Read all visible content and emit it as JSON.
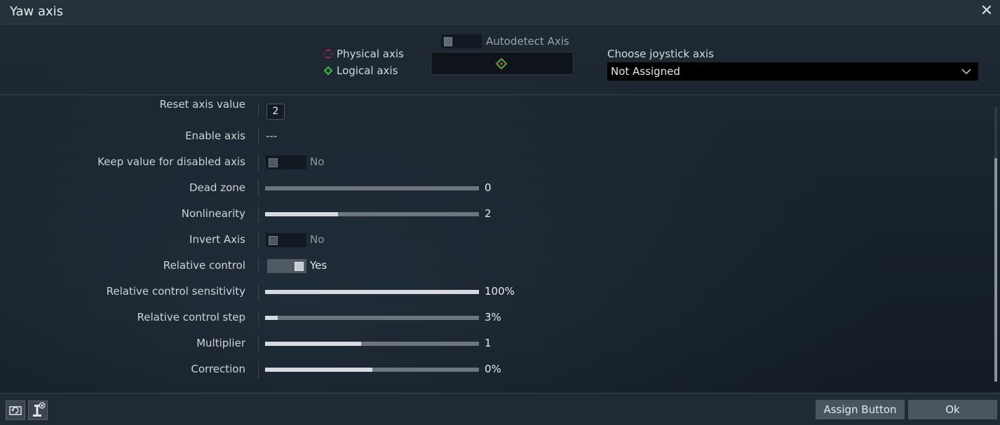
{
  "window": {
    "title": "Yaw axis"
  },
  "legend": {
    "physical": "Physical axis",
    "logical": "Logical axis"
  },
  "autodetect": {
    "label": "Autodetect Axis",
    "enabled": false
  },
  "joystick_axis": {
    "label": "Choose joystick axis",
    "value": "Not Assigned"
  },
  "settings": {
    "reset_axis_value": {
      "label": "Reset axis value",
      "key": "2"
    },
    "enable_axis": {
      "label": "Enable axis",
      "value": "---"
    },
    "keep_value": {
      "label": "Keep value for disabled axis",
      "value": "No",
      "on": false
    },
    "dead_zone": {
      "label": "Dead zone",
      "value": "0",
      "fill": 0.0
    },
    "nonlinearity": {
      "label": "Nonlinearity",
      "value": "2",
      "fill": 0.34
    },
    "invert_axis": {
      "label": "Invert Axis",
      "value": "No",
      "on": false
    },
    "relative_control": {
      "label": "Relative control",
      "value": "Yes",
      "on": true
    },
    "relative_sensitivity": {
      "label": "Relative control sensitivity",
      "value": "100%",
      "fill": 1.0
    },
    "relative_step": {
      "label": "Relative control step",
      "value": "3%",
      "fill": 0.06
    },
    "multiplier": {
      "label": "Multiplier",
      "value": "1",
      "fill": 0.45
    },
    "correction": {
      "label": "Correction",
      "value": "0%",
      "fill": 0.5
    }
  },
  "footer": {
    "assign_button": "Assign Button",
    "ok": "Ok"
  },
  "icons": {
    "close": "close-icon",
    "physical": "physical-axis-icon",
    "logical": "logical-axis-icon",
    "chevron": "chevron-down-icon",
    "reset": "reset-icon",
    "unassign": "unassign-joystick-icon"
  }
}
